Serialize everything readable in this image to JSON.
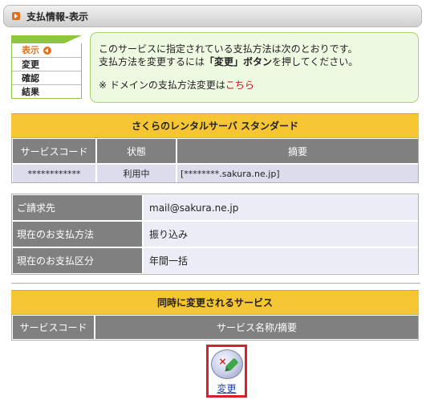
{
  "header": {
    "title": "支払情報-表示"
  },
  "steps": [
    {
      "label": "表示",
      "active": true
    },
    {
      "label": "変更",
      "active": false
    },
    {
      "label": "確認",
      "active": false
    },
    {
      "label": "結果",
      "active": false
    }
  ],
  "info": {
    "line1": "このサービスに指定されている支払方法は次のとおりです。",
    "line2_prefix": "支払方法を変更するには",
    "line2_button": "「変更」ボタン",
    "line2_suffix": "を押してください。",
    "note_prefix": "※ ドメインの支払方法変更は",
    "note_link": "こちら"
  },
  "service_table": {
    "title": "さくらのレンタルサーバ スタンダード",
    "headers": [
      "サービスコード",
      "状態",
      "摘要"
    ],
    "row": [
      "************",
      "利用中",
      "[********.sakura.ne.jp]"
    ]
  },
  "billing": [
    {
      "label": "ご請求先",
      "value": "mail@sakura.ne.jp"
    },
    {
      "label": "現在のお支払方法",
      "value": "振り込み"
    },
    {
      "label": "現在のお支払区分",
      "value": "年間一括"
    }
  ],
  "related_table": {
    "title": "同時に変更されるサービス",
    "headers": [
      "サービスコード",
      "サービス名称/摘要"
    ]
  },
  "change_button": {
    "label": "変更"
  },
  "colors": {
    "accent_orange": "#e0701a",
    "band_yellow": "#f6c533",
    "header_gray": "#808080",
    "highlight_red": "#d8202a"
  }
}
